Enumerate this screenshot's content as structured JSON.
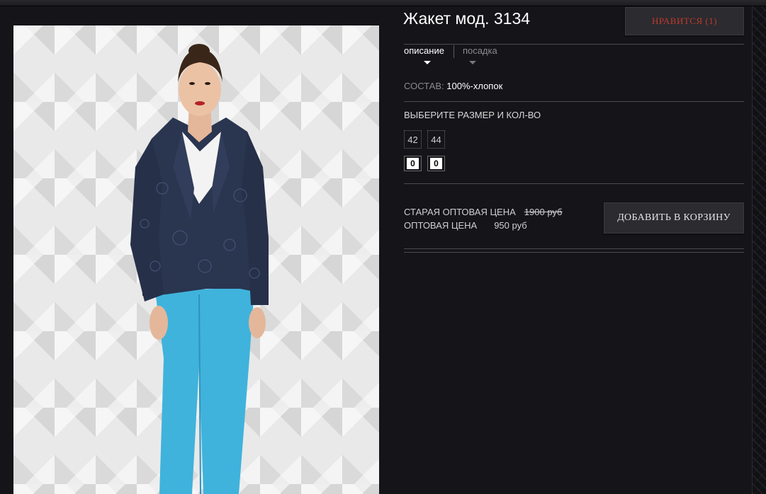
{
  "product": {
    "title": "Жакет мод. 3134",
    "like_label": "НРАВИТСЯ (1)"
  },
  "tabs": [
    {
      "label": "описание",
      "active": true
    },
    {
      "label": "посадка",
      "active": false
    }
  ],
  "composition": {
    "label": "СОСТАВ:",
    "value": "100%-хлопок"
  },
  "sizes": {
    "heading": "ВЫБЕРИТЕ РАЗМЕР И КОЛ-ВО",
    "options": [
      {
        "size": "42",
        "qty": "0"
      },
      {
        "size": "44",
        "qty": "0"
      }
    ]
  },
  "pricing": {
    "old_label": "СТАРАЯ ОПТОВАЯ ЦЕНА",
    "old_value": "1900 руб",
    "new_label": "ОПТОВАЯ ЦЕНА",
    "new_value": "950 руб"
  },
  "cart": {
    "add_label": "ДОБАВИТЬ В КОРЗИНУ"
  },
  "colors": {
    "background": "#141419",
    "button_bg": "#2b2b30",
    "like_text": "#c0392b",
    "divider": "#4a4a50",
    "jacket": "#2a3550",
    "trousers": "#3fb3dc"
  }
}
